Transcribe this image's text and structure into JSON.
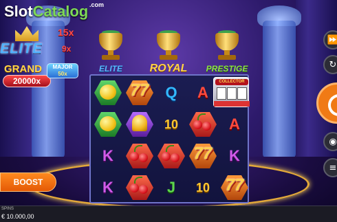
{
  "watermark": {
    "slot": "Slot",
    "catalog": "Catalog",
    "com": ".com"
  },
  "jackpots": {
    "elite": "ELITE",
    "multipliers": [
      "15x",
      "9x"
    ],
    "grand_label": "GRAND",
    "grand_value": "20000x",
    "major_label": "MAJOR",
    "major_value": "50x"
  },
  "trophies": [
    {
      "title": "ELITE",
      "color": "#5ab8ff"
    },
    {
      "title": "ROYAL",
      "color": "#ffd24a"
    },
    {
      "title": "PRESTIGE",
      "color": "#8ee04a"
    }
  ],
  "collector": {
    "label": "COLLECTOR"
  },
  "reels": [
    [
      "lemon",
      "lemon",
      "K",
      "K"
    ],
    [
      "seven",
      "bell",
      "cherry",
      "cherry"
    ],
    [
      "Q",
      "10",
      "cherry",
      "J"
    ],
    [
      "A",
      "cherry",
      "seven",
      "10"
    ],
    [
      "collector",
      "A",
      "K",
      "seven"
    ]
  ],
  "controls": {
    "boost_label": "BOOST"
  },
  "bottom": {
    "spins_label": "SPINS",
    "balance": "€ 10.000,00"
  },
  "colors": {
    "spin": "#f07a15",
    "boost": "#ff8a1f",
    "accent": "#6f74c9"
  }
}
